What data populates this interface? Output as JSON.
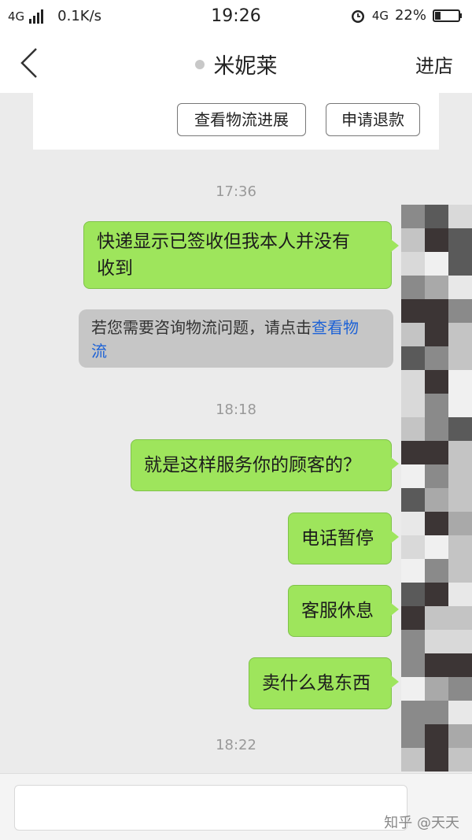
{
  "status_bar": {
    "network_type": "4G",
    "speed": "0.1K/s",
    "time": "19:26",
    "network_type_right": "4G",
    "battery": "22%",
    "icons": [
      "signal-icon",
      "alarm-icon",
      "battery-icon"
    ]
  },
  "nav": {
    "title": "米妮莱",
    "shop_link": "进店",
    "back_icon": "chevron-left-icon"
  },
  "order_card": {
    "logistics_button": "查看物流进展",
    "refund_button": "申请退款"
  },
  "chat": {
    "timestamps": [
      "17:36",
      "18:18",
      "18:22"
    ],
    "messages": [
      {
        "text_line1": "快递显示已签收但我本人并没有",
        "text_line2": "收到"
      },
      {
        "text": "就是这样服务你的顾客的？"
      },
      {
        "text": "电话暂停"
      },
      {
        "text": "客服休息"
      },
      {
        "text": "卖什么鬼东西"
      }
    ],
    "system_message": {
      "text": "若您需要咨询物流问题，请点击",
      "link_line1": "查看物",
      "link_line2": "流"
    }
  },
  "input": {
    "placeholder": "",
    "watermark": "知乎 @天天"
  },
  "colors": {
    "bubble_green": "#9ee55c",
    "link_blue": "#1d62d6",
    "background": "#ebebeb"
  }
}
